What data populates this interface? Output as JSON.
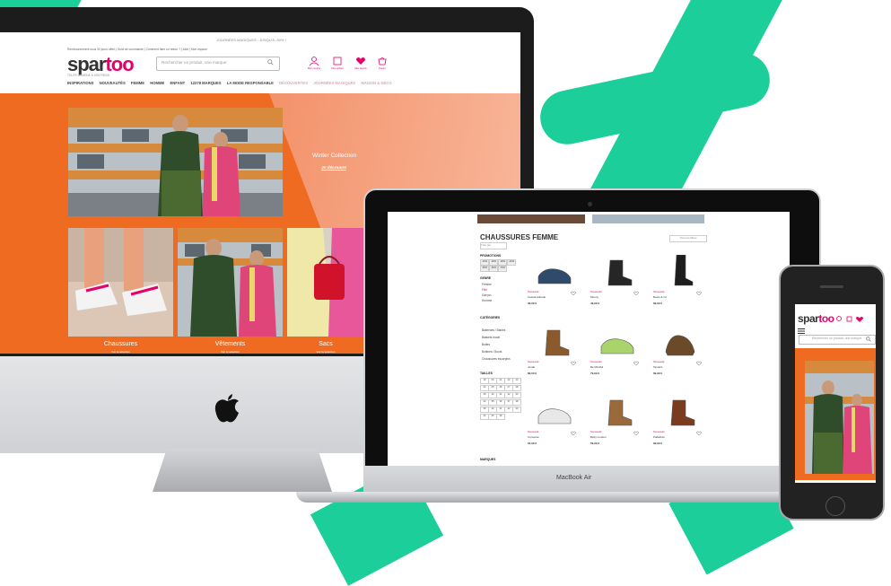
{
  "colors": {
    "brand_green": "#1ccf9a",
    "brand_pink": "#e5006b",
    "hero_orange": "#ef6b22"
  },
  "desktop": {
    "top_bar": "JOURNÉES MAGIQUES : JUSQU'À -50% !",
    "top_links": "Remboursement sous 30 jours offert | Suivi de commande | Comment faire un retour ? | Aide | Mon espace",
    "logo": {
      "first": "spar",
      "second": "too"
    },
    "tagline": "TOUTE LA MODE À VOS PIEDS",
    "search_placeholder": "Rechercher un produit, une marque",
    "header_icons": [
      {
        "name": "account-icon",
        "label": "Mon compte"
      },
      {
        "name": "orders-icon",
        "label": "Mes achats"
      },
      {
        "name": "favorites-icon",
        "label": "Mes favoris"
      },
      {
        "name": "cart-icon",
        "label": "Panier"
      }
    ],
    "menu": [
      "INSPIRATIONS",
      "NOUVEAUTÉS",
      "FEMME",
      "HOMME",
      "ENFANT",
      "12278 MARQUES",
      "LA MODE RESPONSABLE",
      "DÉCOUVERTES",
      "JOURNÉES MAGIQUES",
      "MAISON & DÉCO"
    ],
    "hero": {
      "title": "Winter Collection",
      "cta": "Je découvre"
    },
    "tiles": [
      {
        "label": "Chaussures",
        "sub": "Voir la sélection"
      },
      {
        "label": "Vêtements",
        "sub": "Voir la sélection"
      },
      {
        "label": "Sacs",
        "sub": "Voir la sélection"
      }
    ]
  },
  "laptop": {
    "model": "MacBook Air",
    "category_title": "CHAUSSURES FEMME",
    "category_count": "(52397 articles)",
    "sort_label": "Trier par",
    "filters_button": "Tous les filtres",
    "facets": {
      "promotions": "PROMOTIONS",
      "promo_values": [
        "-10%",
        "-20%",
        "-30%",
        "-40%",
        "-50%",
        "-60%",
        "-70%"
      ],
      "genre": "GENRE",
      "genre_values": [
        "Femme",
        "Fille",
        "Garçon",
        "Homme"
      ],
      "categories": "CATÉGORIES",
      "category_values": [
        "Ballerines / Babies",
        "Baskets mode",
        "Bottes",
        "Bottines / Boots",
        "Chaussures escarpins"
      ],
      "sizes": "TAILLES",
      "size_values": [
        "19",
        "20",
        "21",
        "22",
        "23",
        "24",
        "25",
        "26",
        "27",
        "28",
        "29",
        "30",
        "31",
        "32",
        "33",
        "34",
        "35",
        "36",
        "37",
        "38",
        "39",
        "40",
        "41",
        "42",
        "43",
        "44",
        "45",
        "46"
      ],
      "brands": "MARQUES"
    },
    "products": [
      {
        "badge": "Nouveauté",
        "name": "Casual Attitude",
        "price": "39,99 €",
        "color": "#2f4a6b",
        "icon": "loafer-shoe-icon"
      },
      {
        "badge": "Nouveauté",
        "name": "Moony",
        "price": "49,99 €",
        "color": "#262626",
        "icon": "ankle-boot-icon"
      },
      {
        "badge": "Nouveauté",
        "name": "Boots & Co",
        "price": "69,99 €",
        "color": "#1d1d1d",
        "icon": "tall-boot-icon"
      },
      {
        "badge": "Nouveauté",
        "name": "Jonak",
        "price": "89,00 €",
        "color": "#8a5a2c",
        "icon": "chelsea-boot-icon"
      },
      {
        "badge": "Nouveauté",
        "name": "Be Mindful",
        "price": "79,99 €",
        "color": "#a9d46b",
        "icon": "sneaker-icon"
      },
      {
        "badge": "Nouveauté",
        "name": "Tamaris",
        "price": "69,99 €",
        "color": "#6b4a2a",
        "icon": "sandal-icon"
      },
      {
        "badge": "Nouveauté",
        "name": "Converse",
        "price": "64,99 €",
        "color": "#e8e8e8",
        "icon": "canvas-sneaker-icon"
      },
      {
        "badge": "Nouveauté",
        "name": "Betty London",
        "price": "59,99 €",
        "color": "#9a6a3a",
        "icon": "western-boot-icon"
      },
      {
        "badge": "Nouveauté",
        "name": "Palladium",
        "price": "99,99 €",
        "color": "#7a3b1e",
        "icon": "lace-boot-icon"
      }
    ]
  },
  "phone": {
    "logo": {
      "first": "spar",
      "second": "too"
    },
    "search_placeholder": "Rechercher un produit, une marque"
  }
}
